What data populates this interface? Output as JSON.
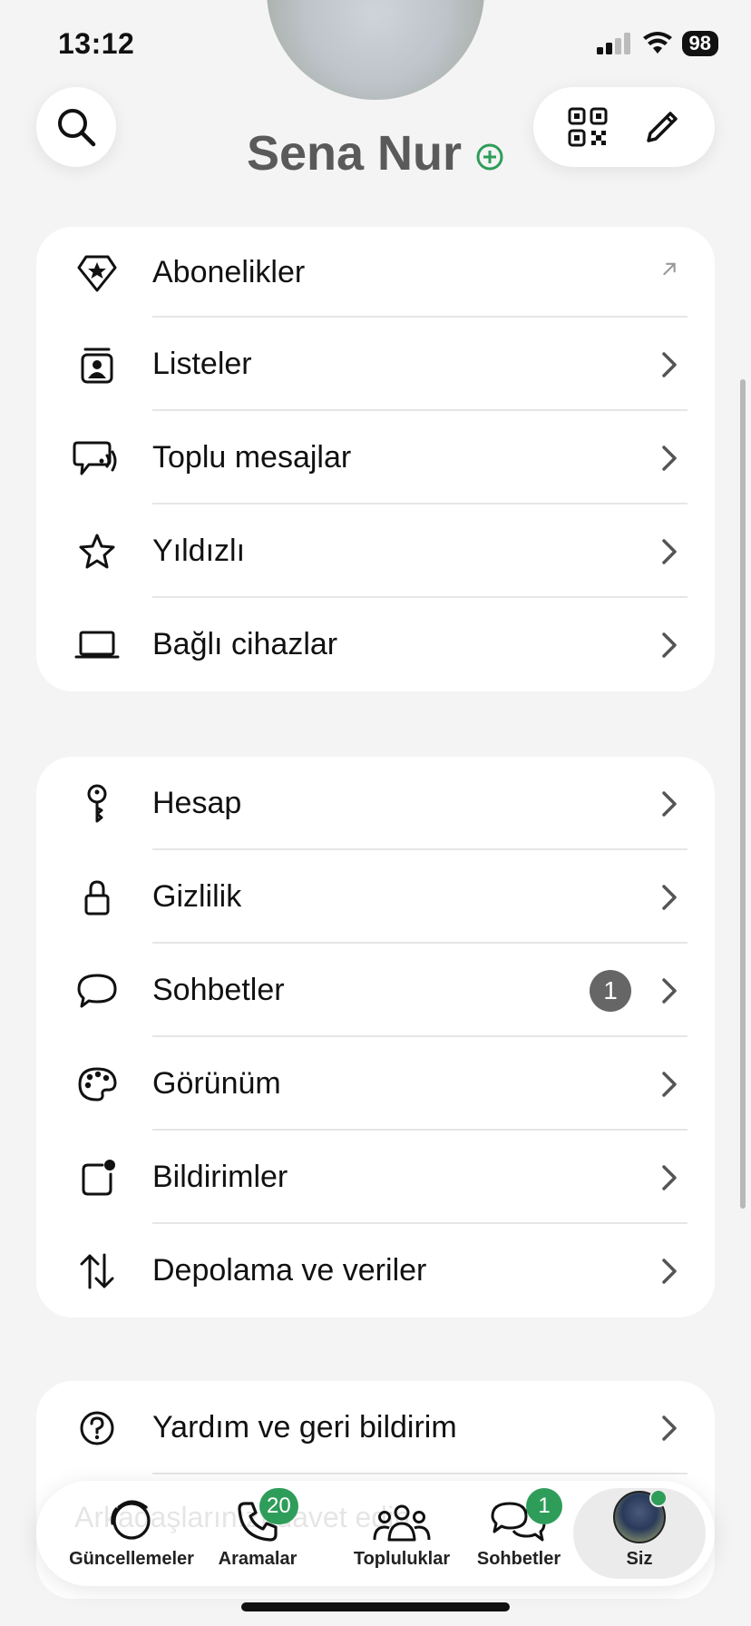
{
  "status": {
    "time": "13:12",
    "battery": "98"
  },
  "profile": {
    "name": "Sena Nur",
    "add_symbol": "+"
  },
  "group1": [
    {
      "label": "Abonelikler",
      "icon": "premium-badge-icon",
      "trail": "external"
    },
    {
      "label": "Listeler",
      "icon": "contact-list-icon",
      "trail": "chevron"
    },
    {
      "label": "Toplu mesajlar",
      "icon": "broadcast-icon",
      "trail": "chevron"
    },
    {
      "label": "Yıldızlı",
      "icon": "star-icon",
      "trail": "chevron"
    },
    {
      "label": "Bağlı cihazlar",
      "icon": "laptop-icon",
      "trail": "chevron"
    }
  ],
  "group2": [
    {
      "label": "Hesap",
      "icon": "key-icon",
      "trail": "chevron"
    },
    {
      "label": "Gizlilik",
      "icon": "lock-icon",
      "trail": "chevron"
    },
    {
      "label": "Sohbetler",
      "icon": "chat-bubble-icon",
      "trail": "chevron",
      "badge": "1"
    },
    {
      "label": "Görünüm",
      "icon": "palette-icon",
      "trail": "chevron"
    },
    {
      "label": "Bildirimler",
      "icon": "notification-icon",
      "trail": "chevron"
    },
    {
      "label": "Depolama ve veriler",
      "icon": "data-transfer-icon",
      "trail": "chevron"
    }
  ],
  "group3": [
    {
      "label": "Yardım ve geri bildirim",
      "icon": "help-icon",
      "trail": "chevron"
    }
  ],
  "ghost_text": "Arkadaşlarınızı davet edin",
  "tabs": [
    {
      "label": "Güncellemeler",
      "icon": "updates-icon"
    },
    {
      "label": "Aramalar",
      "icon": "phone-icon",
      "badge": "20"
    },
    {
      "label": "Topluluklar",
      "icon": "communities-icon"
    },
    {
      "label": "Sohbetler",
      "icon": "chats-icon",
      "badge": "1"
    },
    {
      "label": "Siz",
      "icon": "profile-avatar-icon",
      "active": true
    }
  ],
  "colors": {
    "accent": "#2e9d5a",
    "background": "#f4f4f4",
    "card": "#ffffff"
  }
}
